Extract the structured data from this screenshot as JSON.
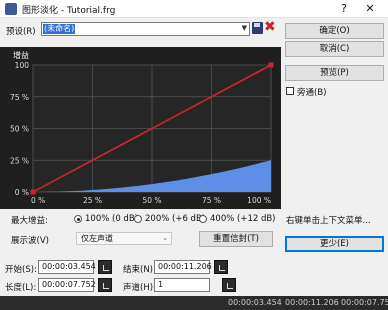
{
  "window": {
    "title": "图形淡化 - Tutorial.frg",
    "help_label": "?",
    "close_label": "✕"
  },
  "preset": {
    "label": "预设(R)",
    "value": "(未命名)"
  },
  "buttons": {
    "ok": "确定(O)",
    "cancel": "取消(C)",
    "preview": "预览(P)",
    "reset": "重置信封(T)",
    "less": "更少(E)"
  },
  "bypass": {
    "label": "旁通(B)",
    "checked": false
  },
  "graph": {
    "title": "增益",
    "y_ticks": [
      "100",
      "75 %",
      "50 %",
      "25 %",
      "0 %"
    ],
    "x_ticks": [
      "0 %",
      "25 %",
      "50 %",
      "75 %",
      "100 %"
    ],
    "line_color": "#c0282d",
    "fill_color": "#5d8fe6"
  },
  "chart_data": {
    "type": "line",
    "title": "增益",
    "x": [
      0,
      25,
      50,
      75,
      100
    ],
    "x_ticks": [
      "0 %",
      "25 %",
      "50 %",
      "75 %",
      "100 %"
    ],
    "y_ticks": [
      "100",
      "75 %",
      "50 %",
      "25 %",
      "0 %"
    ],
    "xlim": [
      0,
      100
    ],
    "ylim": [
      0,
      100
    ],
    "grid": true,
    "series": [
      {
        "values": [
          0,
          25,
          50,
          75,
          100
        ],
        "color": "#c0282d"
      },
      {
        "values": [
          0,
          1.5,
          6,
          14,
          25
        ],
        "color": "#5d8fe6"
      }
    ]
  },
  "max_gain": {
    "label": "最大增益:",
    "options": [
      {
        "label": "100% (0 dB)",
        "selected": true
      },
      {
        "label": "200% (+6 dB)",
        "selected": false
      },
      {
        "label": "400% (+12 dB)",
        "selected": false
      }
    ]
  },
  "show_label": "展示波(V)",
  "show_value": "仅左声道",
  "context_hint": "右键单击上下文菜单...",
  "range": {
    "start_label": "开始(S):",
    "start_value": "00:00:03.454",
    "end_label": "结束(N):",
    "end_value": "00:00:11.206",
    "length_label": "长度(L):",
    "length_value": "00:00:07.752",
    "channel_label": "声道(H):",
    "channel_value": "1"
  },
  "status": {
    "start": "00:00:03.454",
    "end": "00:00:11.206",
    "length": "00:00:07.75"
  }
}
